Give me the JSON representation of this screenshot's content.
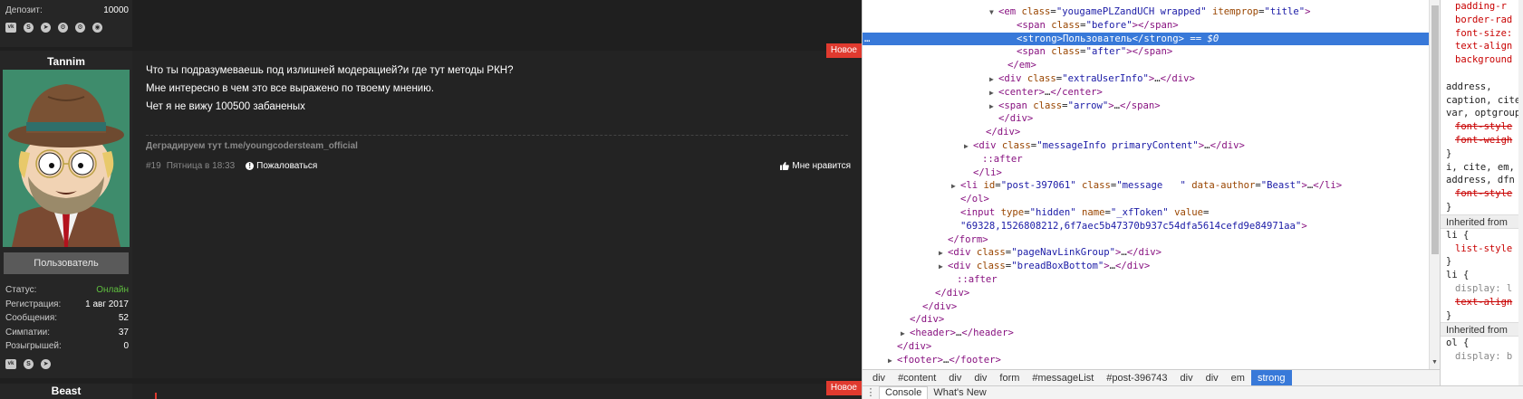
{
  "forum": {
    "prev_user": {
      "stats": [
        {
          "label": "Депозит:",
          "value": "10000"
        }
      ],
      "social": [
        "vk",
        "skype",
        "telegram",
        "steam",
        "steam",
        "web"
      ]
    },
    "post": {
      "badge": "Новое",
      "username": "Tannim",
      "role": "Пользователь",
      "stats": [
        {
          "label": "Статус:",
          "value": "Онлайн",
          "status": true
        },
        {
          "label": "Регистрация:",
          "value": "1 авг 2017"
        },
        {
          "label": "Сообщения:",
          "value": "52"
        },
        {
          "label": "Симпатии:",
          "value": "37"
        },
        {
          "label": "Розыгрышей:",
          "value": "0"
        }
      ],
      "social": [
        "vk",
        "skype",
        "telegram"
      ],
      "lines": [
        "Что ты подразумеваешь под излишней модерацией?и где тут методы РКН?",
        "Мне интересно в чем это все выражено по твоему мнению.",
        "Чет я не вижу 100500 забаненых"
      ],
      "signature": "Деградируем тут t.me/youngcodersteam_official",
      "number": "#19",
      "date": "Пятница в 18:33",
      "report": "Пожаловаться",
      "like": "Мне нравится"
    },
    "next_post": {
      "username": "Beast",
      "badge": "Новое"
    }
  },
  "devtools": {
    "elements": [
      {
        "indent": 140,
        "tri": "▼",
        "html": "<span class='tag'>&lt;em</span> <span class='an'>class</span>=<span class='av'>\"yougamePLZandUCH wrapped\"</span> <span class='an'>itemprop</span>=<span class='av'>\"title\"</span><span class='tag'>&gt;</span>"
      },
      {
        "indent": 160,
        "tri": "",
        "html": "<span class='tag'>&lt;span</span> <span class='an'>class</span>=<span class='av'>\"before\"</span><span class='tag'>&gt;&lt;/span&gt;</span>"
      },
      {
        "indent": 160,
        "tri": "",
        "sel": true,
        "html": "<span class='tag'>&lt;strong&gt;</span><span class='txt'>Пользователь</span><span class='tag'>&lt;/strong&gt;</span> <span class='dim'>== $0</span>"
      },
      {
        "indent": 160,
        "tri": "",
        "html": "<span class='tag'>&lt;span</span> <span class='an'>class</span>=<span class='av'>\"after\"</span><span class='tag'>&gt;&lt;/span&gt;</span>"
      },
      {
        "indent": 150,
        "tri": "",
        "html": "<span class='tag'>&lt;/em&gt;</span>"
      },
      {
        "indent": 140,
        "tri": "▶",
        "html": "<span class='tag'>&lt;div</span> <span class='an'>class</span>=<span class='av'>\"extraUserInfo\"</span><span class='tag'>&gt;</span>…<span class='tag'>&lt;/div&gt;</span>"
      },
      {
        "indent": 140,
        "tri": "▶",
        "html": "<span class='tag'>&lt;center&gt;</span>…<span class='tag'>&lt;/center&gt;</span>"
      },
      {
        "indent": 140,
        "tri": "▶",
        "html": "<span class='tag'>&lt;span</span> <span class='an'>class</span>=<span class='av'>\"arrow\"</span><span class='tag'>&gt;</span>…<span class='tag'>&lt;/span&gt;</span>"
      },
      {
        "indent": 140,
        "tri": "",
        "html": "<span class='tag'>&lt;/div&gt;</span>"
      },
      {
        "indent": 126,
        "tri": "",
        "html": "<span class='tag'>&lt;/div&gt;</span>"
      },
      {
        "indent": 112,
        "tri": "▶",
        "html": "<span class='tag'>&lt;div</span> <span class='an'>class</span>=<span class='av'>\"messageInfo primaryContent\"</span><span class='tag'>&gt;</span>…<span class='tag'>&lt;/div&gt;</span>"
      },
      {
        "indent": 122,
        "tri": "",
        "html": "<span class='tag'>::after</span>"
      },
      {
        "indent": 112,
        "tri": "",
        "html": "<span class='tag'>&lt;/li&gt;</span>"
      },
      {
        "indent": 98,
        "tri": "▶",
        "html": "<span class='tag'>&lt;li</span> <span class='an'>id</span>=<span class='av'>\"post-397061\"</span> <span class='an'>class</span>=<span class='av'>\"message   \"</span> <span class='an'>data-author</span>=<span class='av'>\"Beast\"</span><span class='tag'>&gt;</span>…<span class='tag'>&lt;/li&gt;</span>"
      },
      {
        "indent": 98,
        "tri": "",
        "html": "<span class='tag'>&lt;/ol&gt;</span>"
      },
      {
        "indent": 98,
        "tri": "",
        "html": "<span class='tag'>&lt;input</span> <span class='an'>type</span>=<span class='av'>\"hidden\"</span> <span class='an'>name</span>=<span class='av'>\"_xfToken\"</span> <span class='an'>value</span>="
      },
      {
        "indent": 98,
        "tri": "",
        "html": "<span class='av'>\"69328,1526808212,6f7aec5b47370b937c54dfa5614cefd9e84971aa\"</span><span class='tag'>&gt;</span>"
      },
      {
        "indent": 84,
        "tri": "",
        "html": "<span class='tag'>&lt;/form&gt;</span>"
      },
      {
        "indent": 84,
        "tri": "▶",
        "html": "<span class='tag'>&lt;div</span> <span class='an'>class</span>=<span class='av'>\"pageNavLinkGroup\"</span><span class='tag'>&gt;</span>…<span class='tag'>&lt;/div&gt;</span>"
      },
      {
        "indent": 84,
        "tri": "▶",
        "html": "<span class='tag'>&lt;div</span> <span class='an'>class</span>=<span class='av'>\"breadBoxBottom\"</span><span class='tag'>&gt;</span>…<span class='tag'>&lt;/div&gt;</span>"
      },
      {
        "indent": 94,
        "tri": "",
        "html": "<span class='tag'>::after</span>"
      },
      {
        "indent": 70,
        "tri": "",
        "html": "<span class='tag'>&lt;/div&gt;</span>"
      },
      {
        "indent": 56,
        "tri": "",
        "html": "<span class='tag'>&lt;/div&gt;</span>"
      },
      {
        "indent": 42,
        "tri": "",
        "html": "<span class='tag'>&lt;/div&gt;</span>"
      },
      {
        "indent": 42,
        "tri": "▶",
        "html": "<span class='tag'>&lt;header&gt;</span>…<span class='tag'>&lt;/header&gt;</span>"
      },
      {
        "indent": 28,
        "tri": "",
        "html": "<span class='tag'>&lt;/div&gt;</span>"
      },
      {
        "indent": 28,
        "tri": "▶",
        "html": "<span class='tag'>&lt;footer&gt;</span>…<span class='tag'>&lt;/footer&gt;</span>"
      }
    ],
    "breadcrumbs": [
      "div",
      "#content",
      "div",
      "div",
      "form",
      "#messageList",
      "#post-396743",
      "div",
      "div",
      "em",
      "strong"
    ],
    "drawer_tabs": [
      "Console",
      "What's New"
    ],
    "styles": [
      {
        "type": "prop",
        "html": "<span class='pn'>padding-r</span>"
      },
      {
        "type": "prop",
        "html": "<span class='pn'>border-rad</span>"
      },
      {
        "type": "prop",
        "html": "<span class='pn'>font-size:</span>"
      },
      {
        "type": "prop",
        "html": "<span class='pn'>text-align</span>"
      },
      {
        "type": "prop",
        "html": "<span class='pn'>background</span>"
      },
      {
        "type": "blank",
        "html": ""
      },
      {
        "type": "sel",
        "html": "<span class='selector'>address,</span>"
      },
      {
        "type": "sel",
        "html": "<span class='selector'>caption, cite</span>"
      },
      {
        "type": "sel",
        "html": "<span class='selector'>var, optgroup</span>"
      },
      {
        "type": "prop",
        "html": "<span class='strike'>font-style</span>"
      },
      {
        "type": "prop",
        "html": "<span class='strike'>font-weigh</span>"
      },
      {
        "type": "sel",
        "html": "}"
      },
      {
        "type": "sel",
        "html": "<span class='selector'>i, cite, em,</span>"
      },
      {
        "type": "sel",
        "html": "<span class='selector'>address, dfn</span>"
      },
      {
        "type": "prop",
        "html": "<span class='strike'>font-style</span>"
      },
      {
        "type": "sel",
        "html": "}"
      },
      {
        "type": "inh",
        "html": "Inherited from"
      },
      {
        "type": "sel",
        "html": "<span class='selector'>li {</span>"
      },
      {
        "type": "prop",
        "html": "<span class='pn'>list-style</span>"
      },
      {
        "type": "sel",
        "html": "}"
      },
      {
        "type": "sel",
        "html": "<span class='selector'>li {</span>"
      },
      {
        "type": "prop",
        "html": "<span class='ua'>display: l</span>"
      },
      {
        "type": "prop",
        "html": "<span class='strike'>text-align</span>"
      },
      {
        "type": "sel",
        "html": "}"
      },
      {
        "type": "inh",
        "html": "Inherited from"
      },
      {
        "type": "sel",
        "html": "<span class='selector'>ol {</span>"
      },
      {
        "type": "prop",
        "html": "<span class='ua'>display: b</span>"
      }
    ]
  }
}
